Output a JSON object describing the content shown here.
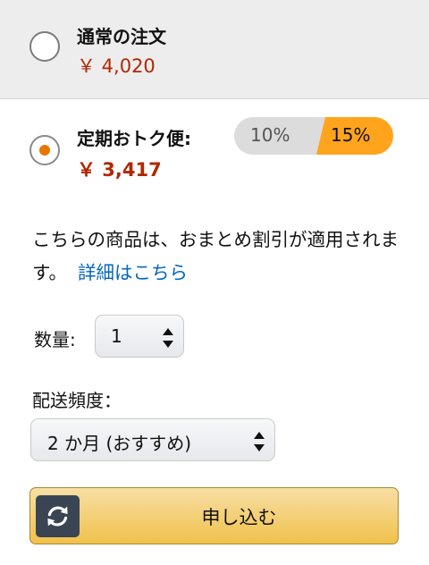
{
  "one_time": {
    "title": "通常の注文",
    "price": "￥ 4,020",
    "selected": false
  },
  "subscription": {
    "title": "定期おトク便:",
    "price": "￥ 3,417",
    "selected": true,
    "discount_low": "10%",
    "discount_high": "15%"
  },
  "description": {
    "text": "こちらの商品は、おまとめ割引が適用されます。",
    "link": "詳細はこちら"
  },
  "quantity": {
    "label": "数量:",
    "value": "1"
  },
  "frequency": {
    "label": "配送頻度：",
    "value": "2 か月 (おすすめ)"
  },
  "subscribe_button": {
    "label": "申し込む",
    "icon": "refresh-icon"
  },
  "colors": {
    "price": "#b12704",
    "accent_orange": "#ffa41c",
    "radio_dot": "#e77600",
    "link": "#0066c0",
    "button_top": "#f7dfa5",
    "button_bottom": "#f0c14b",
    "option_bg": "#ededed"
  }
}
